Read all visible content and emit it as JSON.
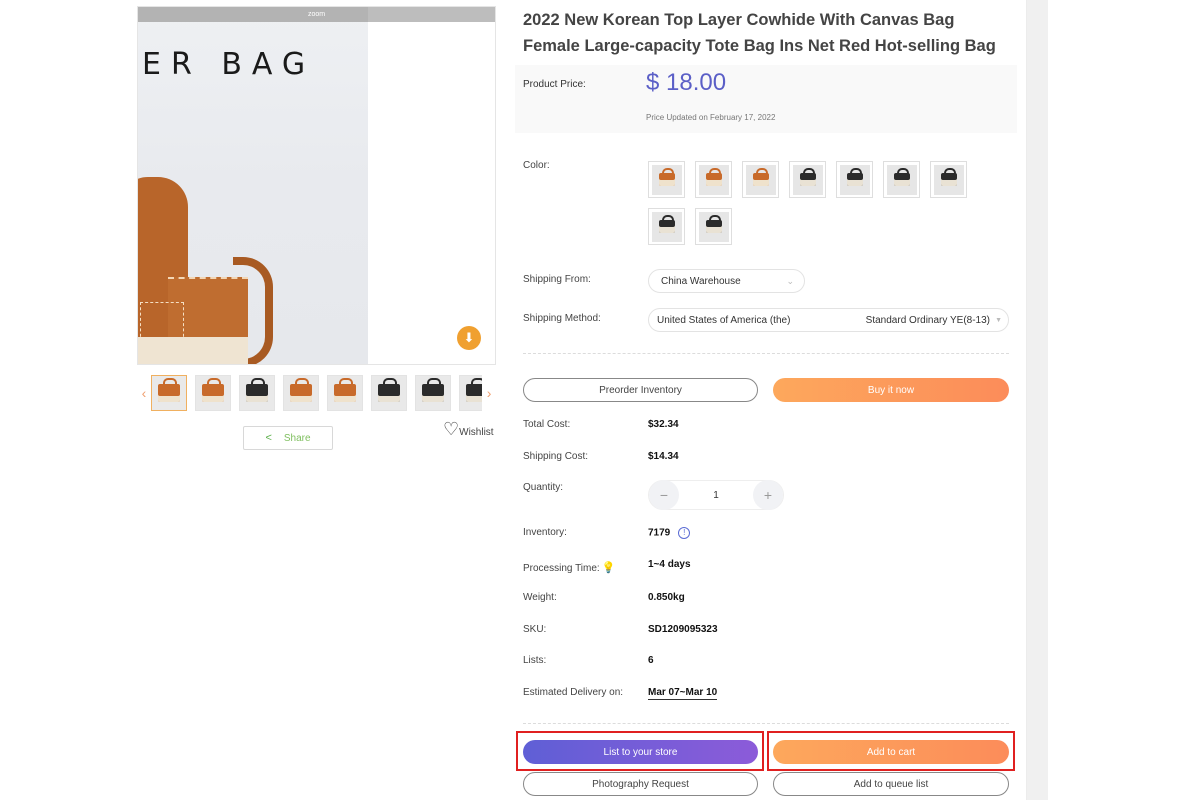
{
  "gallery": {
    "zoom_label": "zoom",
    "photo_text": "ER BAG",
    "download_icon": "cloud-download-icon",
    "prev_icon": "‹",
    "next_icon": "›",
    "thumbnails": [
      {
        "variant": "tan",
        "active": true
      },
      {
        "variant": "tan",
        "active": false
      },
      {
        "variant": "dark",
        "active": false
      },
      {
        "variant": "tan",
        "active": false
      },
      {
        "variant": "tan",
        "active": false
      },
      {
        "variant": "dark",
        "active": false
      },
      {
        "variant": "dark",
        "active": false
      },
      {
        "variant": "dark",
        "active": false
      }
    ],
    "share_label": "Share",
    "wishlist_label": "Wishlist"
  },
  "product": {
    "title": "2022 New Korean Top Layer Cowhide With Canvas Bag Female Large-capacity Tote Bag Ins Net Red Hot-selling Bag",
    "price_label": "Product Price:",
    "price": "$ 18.00",
    "price_updated": "Price Updated on February 17, 2022",
    "price_color": "#5b5fc7"
  },
  "options": {
    "color_label": "Color:",
    "colors": [
      "tan",
      "tan",
      "tan",
      "dark",
      "dark",
      "dark",
      "dark",
      "dark",
      "dark"
    ],
    "shipping_from_label": "Shipping From:",
    "shipping_from_value": "China Warehouse",
    "shipping_method_label": "Shipping Method:",
    "shipping_country": "United States of America (the)",
    "shipping_method": "Standard Ordinary YE(8-13)"
  },
  "actions": {
    "preorder": "Preorder Inventory",
    "buy_now": "Buy it now",
    "list_to_store": "List to your store",
    "add_to_cart": "Add to cart",
    "photography_request": "Photography Request",
    "add_to_queue": "Add to queue list"
  },
  "details": {
    "total_cost_label": "Total Cost:",
    "total_cost": "$32.34",
    "shipping_cost_label": "Shipping Cost:",
    "shipping_cost": "$14.34",
    "quantity_label": "Quantity:",
    "quantity": "1",
    "minus": "−",
    "plus": "+",
    "inventory_label": "Inventory:",
    "inventory": "7179",
    "info_glyph": "!",
    "processing_label": "Processing Time:",
    "processing": "1~4 days",
    "weight_label": "Weight:",
    "weight": "0.850kg",
    "sku_label": "SKU:",
    "sku": "SD1209095323",
    "lists_label": "Lists:",
    "lists": "6",
    "delivery_label": "Estimated Delivery on:",
    "delivery": "Mar 07~Mar 10"
  },
  "colors": {
    "accent_purple": "#5b5fc7",
    "orange_start": "#fda85c",
    "orange_end": "#fc8c5a",
    "highlight_red": "#e02020"
  }
}
